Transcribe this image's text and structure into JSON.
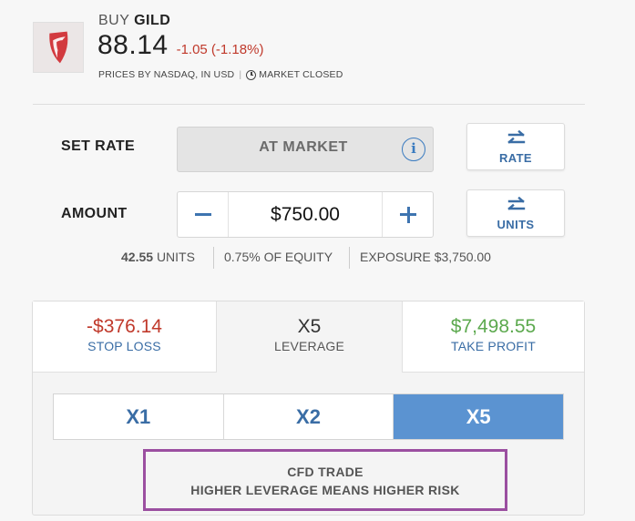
{
  "header": {
    "action": "BUY",
    "symbol": "GILD",
    "price": "88.14",
    "change": "-1.05 (-1.18%)",
    "prices_by": "PRICES BY NASDAQ, IN USD",
    "separator": "|",
    "market_status": "MARKET CLOSED",
    "logo_icon": "gilead-logo-icon"
  },
  "order": {
    "set_rate_label": "SET RATE",
    "rate_value": "AT MARKET",
    "info_symbol": "i",
    "rate_toggle_label": "RATE",
    "amount_label": "AMOUNT",
    "amount_value": "$750.00",
    "units_toggle_label": "UNITS"
  },
  "stats": {
    "units_number": "42.55",
    "units_word": "UNITS",
    "equity": "0.75% OF EQUITY",
    "exposure": "EXPOSURE $3,750.00"
  },
  "tabs": [
    {
      "value": "-$376.14",
      "label": "STOP LOSS"
    },
    {
      "value": "X5",
      "label": "LEVERAGE"
    },
    {
      "value": "$7,498.55",
      "label": "TAKE PROFIT"
    }
  ],
  "leverage_options": [
    "X1",
    "X2",
    "X5"
  ],
  "leverage_selected": "X5",
  "warning": {
    "line1": "CFD TRADE",
    "line2": "HIGHER LEVERAGE MEANS HIGHER RISK"
  },
  "colors": {
    "accent_blue": "#3a6da5",
    "negative_red": "#c0392b",
    "positive_green": "#5ca94e",
    "selected_leverage": "#5b93d1",
    "warning_border": "#9b4fa0"
  }
}
